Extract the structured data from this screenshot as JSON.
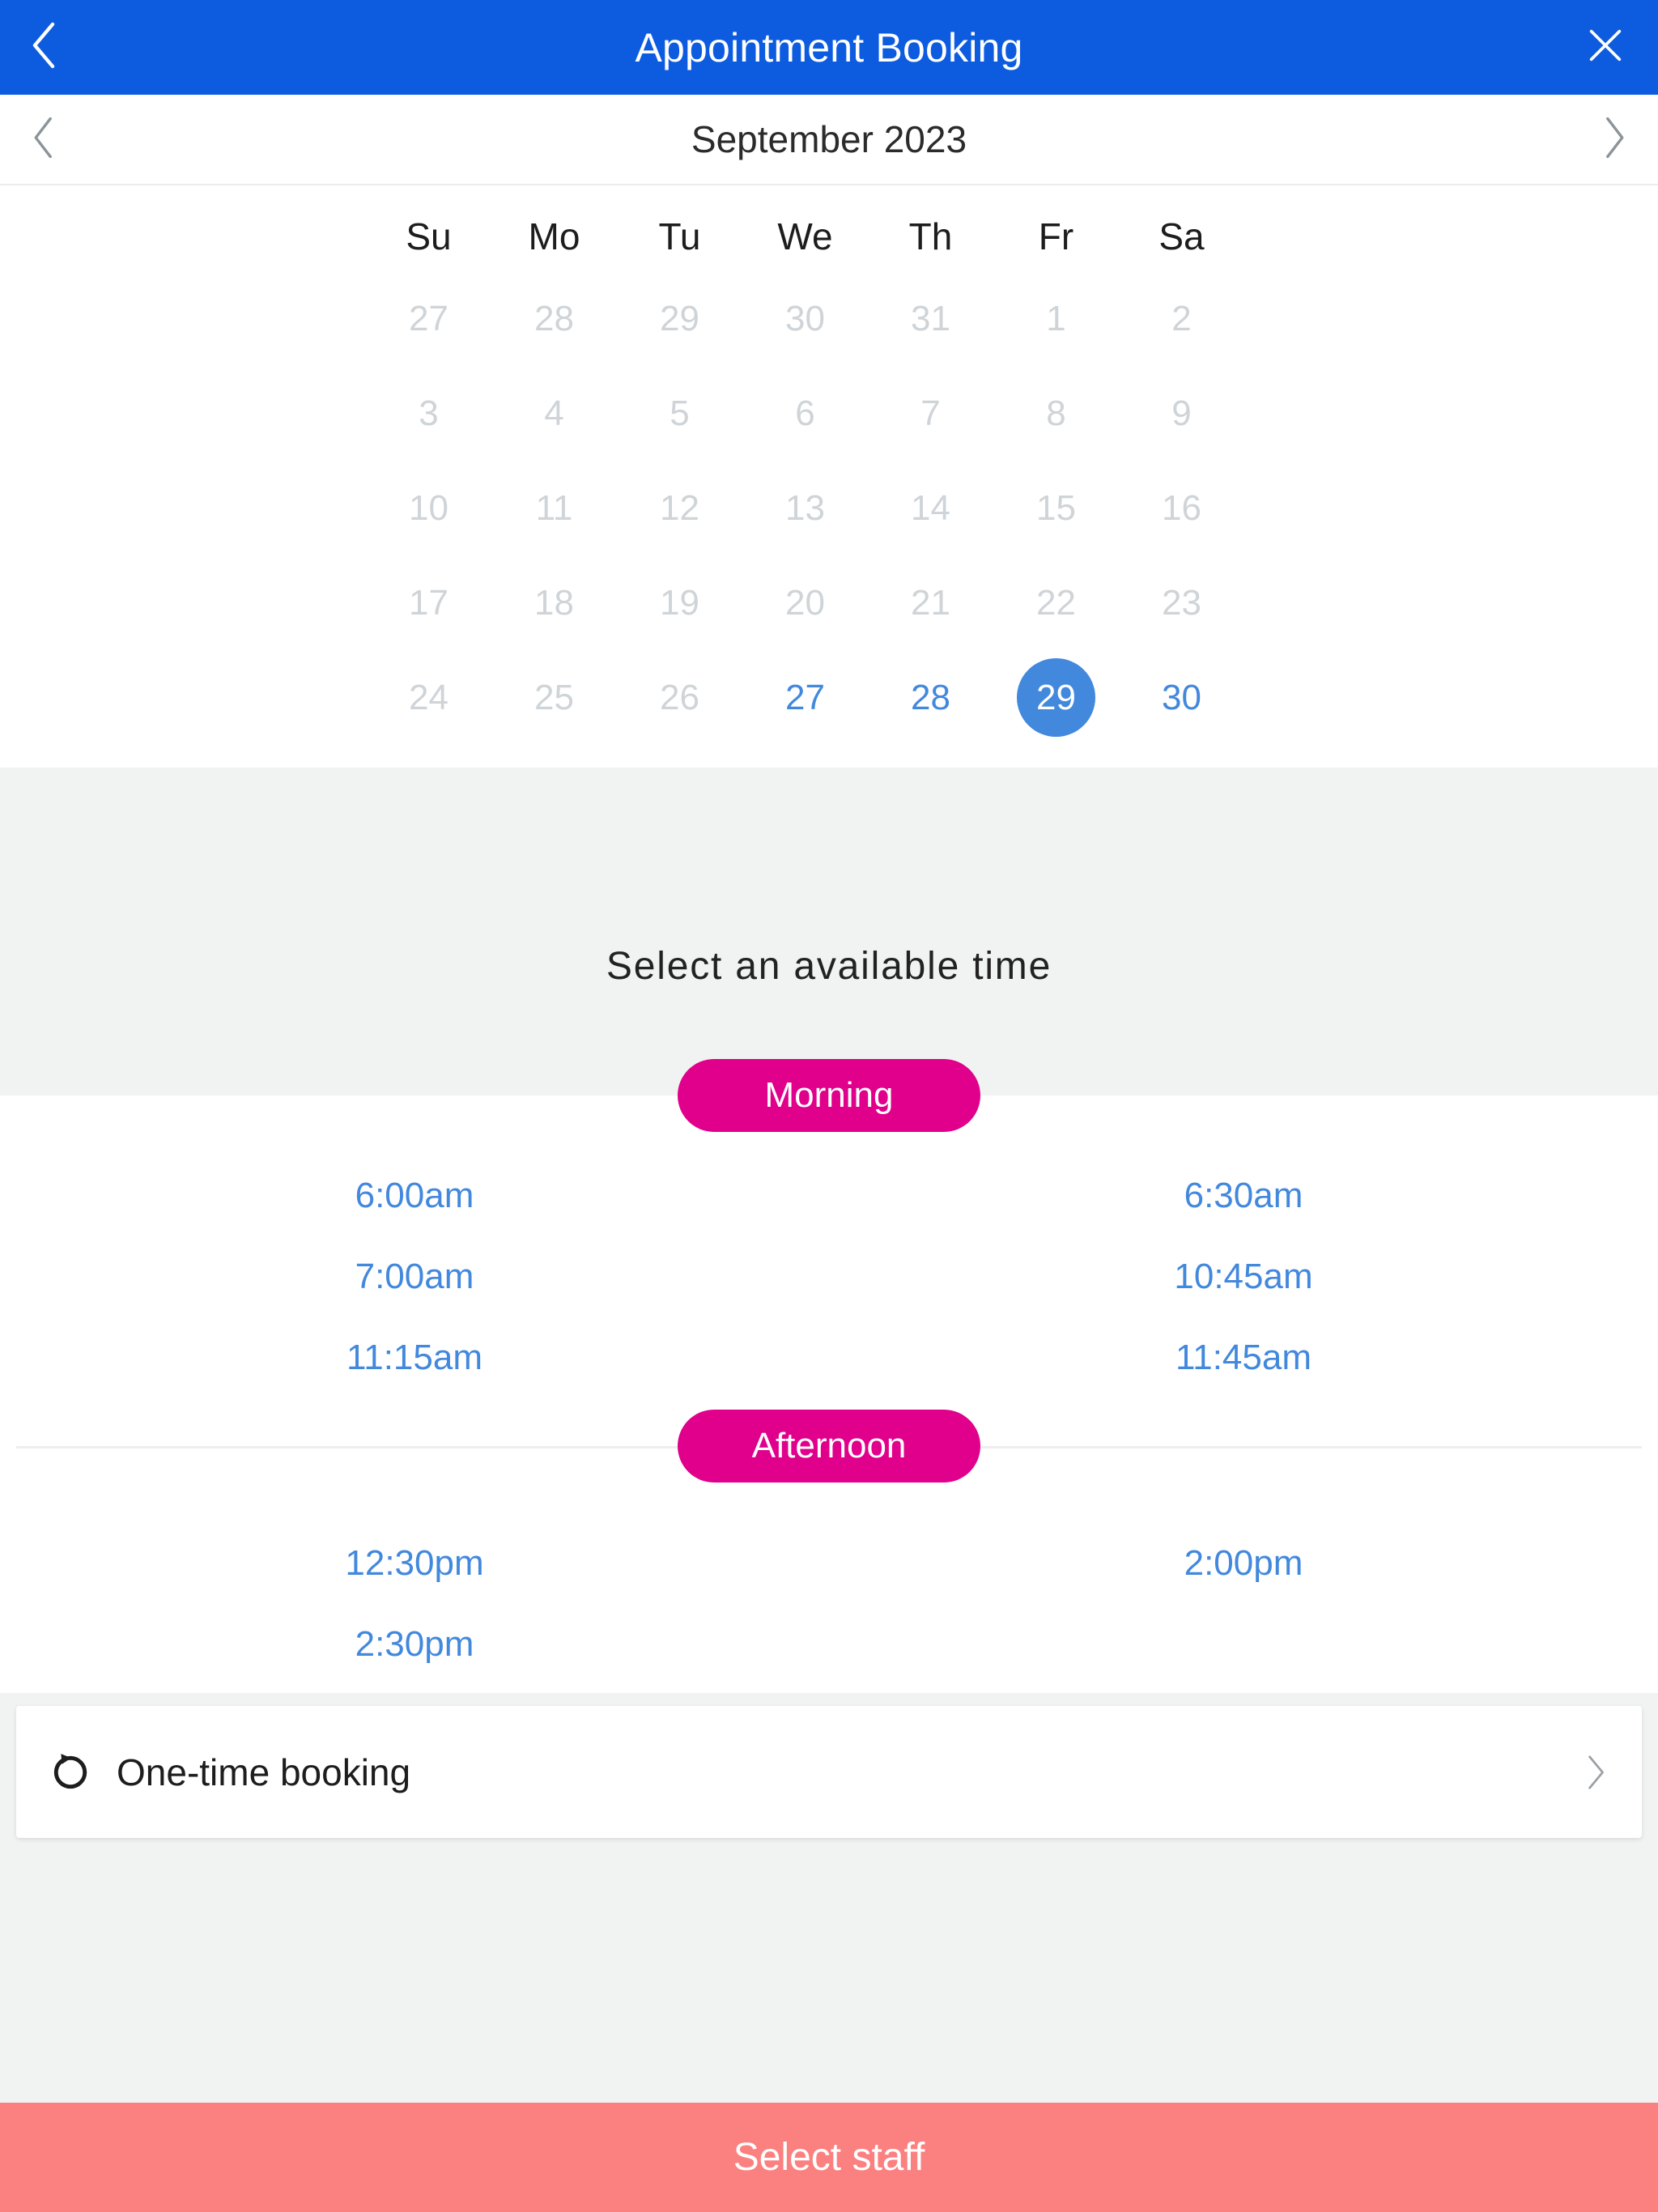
{
  "header": {
    "title": "Appointment Booking",
    "back_icon": "chevron-left-icon",
    "close_icon": "close-icon"
  },
  "month_nav": {
    "label": "September 2023",
    "prev_icon": "chevron-left-icon",
    "next_icon": "chevron-right-icon"
  },
  "calendar": {
    "weekdays": [
      "Su",
      "Mo",
      "Tu",
      "We",
      "Th",
      "Fr",
      "Sa"
    ],
    "weeks": [
      [
        {
          "day": "27",
          "state": "muted"
        },
        {
          "day": "28",
          "state": "muted"
        },
        {
          "day": "29",
          "state": "muted"
        },
        {
          "day": "30",
          "state": "muted"
        },
        {
          "day": "31",
          "state": "muted"
        },
        {
          "day": "1",
          "state": "muted"
        },
        {
          "day": "2",
          "state": "muted"
        }
      ],
      [
        {
          "day": "3",
          "state": "muted"
        },
        {
          "day": "4",
          "state": "muted"
        },
        {
          "day": "5",
          "state": "muted"
        },
        {
          "day": "6",
          "state": "muted"
        },
        {
          "day": "7",
          "state": "muted"
        },
        {
          "day": "8",
          "state": "muted"
        },
        {
          "day": "9",
          "state": "muted"
        }
      ],
      [
        {
          "day": "10",
          "state": "muted"
        },
        {
          "day": "11",
          "state": "muted"
        },
        {
          "day": "12",
          "state": "muted"
        },
        {
          "day": "13",
          "state": "muted"
        },
        {
          "day": "14",
          "state": "muted"
        },
        {
          "day": "15",
          "state": "muted"
        },
        {
          "day": "16",
          "state": "muted"
        }
      ],
      [
        {
          "day": "17",
          "state": "muted"
        },
        {
          "day": "18",
          "state": "muted"
        },
        {
          "day": "19",
          "state": "muted"
        },
        {
          "day": "20",
          "state": "muted"
        },
        {
          "day": "21",
          "state": "muted"
        },
        {
          "day": "22",
          "state": "muted"
        },
        {
          "day": "23",
          "state": "muted"
        }
      ],
      [
        {
          "day": "24",
          "state": "muted"
        },
        {
          "day": "25",
          "state": "muted"
        },
        {
          "day": "26",
          "state": "muted"
        },
        {
          "day": "27",
          "state": "available"
        },
        {
          "day": "28",
          "state": "available"
        },
        {
          "day": "29",
          "state": "selected"
        },
        {
          "day": "30",
          "state": "available"
        }
      ]
    ],
    "selected_date": "29"
  },
  "time_section": {
    "heading": "Select an available time",
    "morning_label": "Morning",
    "afternoon_label": "Afternoon",
    "morning_slots": [
      "6:00am",
      "6:30am",
      "7:00am",
      "10:45am",
      "11:15am",
      "11:45am"
    ],
    "afternoon_slots": [
      "12:30pm",
      "2:00pm",
      "2:30pm"
    ]
  },
  "booking_option": {
    "label": "One-time booking",
    "icon": "repeat-icon",
    "chevron_icon": "chevron-right-icon"
  },
  "cta": {
    "label": "Select staff"
  },
  "colors": {
    "header_blue": "#0d5ce0",
    "accent_blue": "#4288dd",
    "magenta": "#e0008c",
    "cta_salmon": "#fb8080",
    "band_gray": "#f1f2f2",
    "muted_gray": "#cfd4d8"
  }
}
